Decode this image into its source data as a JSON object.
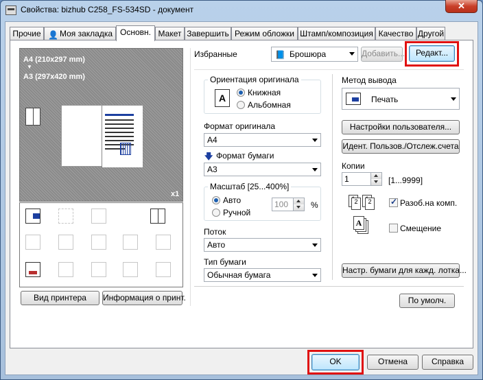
{
  "window": {
    "title": "Свойства: bizhub C258_FS-534SD - документ",
    "close_glyph": "✕"
  },
  "tabs": [
    {
      "label": "Прочие",
      "active": false
    },
    {
      "label": "Моя закладка",
      "active": false
    },
    {
      "label": "Основн.",
      "active": true
    },
    {
      "label": "Макет",
      "active": false
    },
    {
      "label": "Завершить",
      "active": false
    },
    {
      "label": "Режим обложки",
      "active": false
    },
    {
      "label": "Штамп/композиция",
      "active": false
    },
    {
      "label": "Качество",
      "active": false
    },
    {
      "label": "Другой",
      "active": false
    }
  ],
  "preview": {
    "line1": "A4 (210x297 mm)",
    "arrow": "▼",
    "line2": "A3 (297x420 mm)",
    "copies_badge": "x1"
  },
  "favorites": {
    "label": "Избранные",
    "value": "Брошюра",
    "add_label": "Добавить...",
    "edit_label": "Редакт..."
  },
  "orientation": {
    "legend": "Ориентация оригинала",
    "portrait": "Книжная",
    "landscape": "Альбомная",
    "selected": "portrait"
  },
  "original_size": {
    "label": "Формат оригинала",
    "value": "A4"
  },
  "paper_size": {
    "label": "Формат бумаги",
    "value": "A3"
  },
  "zoom": {
    "legend": "Масштаб [25...400%]",
    "auto": "Авто",
    "manual": "Ручной",
    "selected": "auto",
    "value": "100",
    "unit": "%"
  },
  "tray": {
    "label": "Поток",
    "value": "Авто"
  },
  "paper_type": {
    "label": "Тип бумаги",
    "value": "Обычная бумага"
  },
  "output": {
    "label": "Метод вывода",
    "value": "Печать"
  },
  "user_settings_label": "Настройки пользователя...",
  "user_auth_label": "Идент. Пользов./Отслеж.счета",
  "copies": {
    "label": "Копии",
    "value": "1",
    "range": "[1...9999]"
  },
  "collate": {
    "label": "Разоб.на комп.",
    "checked": true
  },
  "offset": {
    "label": "Смещение",
    "checked": false
  },
  "tray_paper_label": "Настр. бумаги для кажд. лотка...",
  "defaults_label": "По умолч.",
  "printer_view_label": "Вид принтера",
  "printer_info_label": "Информация о принт.",
  "footer": {
    "ok": "OK",
    "cancel": "Отмена",
    "help": "Справка"
  },
  "colors": {
    "highlight": "#e01010",
    "accent_blue": "#1c3fa0"
  }
}
